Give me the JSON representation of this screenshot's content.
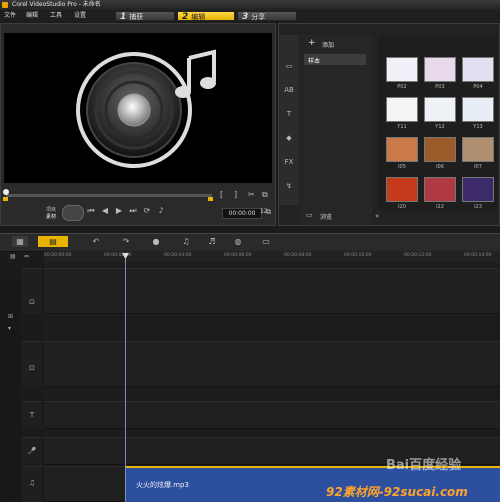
{
  "window": {
    "title": "Corel VideoStudio Pro - 未命名"
  },
  "menu": {
    "items": [
      "文件",
      "编辑",
      "工具",
      "设置"
    ]
  },
  "steps": [
    {
      "num": "1",
      "label": "捕获"
    },
    {
      "num": "2",
      "label": "编辑"
    },
    {
      "num": "3",
      "label": "分享"
    }
  ],
  "player": {
    "mode_top": "项目",
    "mode_bottom": "素材",
    "timecode": "00:00:00",
    "timecode_suffix": "12"
  },
  "library": {
    "add_label": "添加",
    "nav_items": [
      "样本"
    ],
    "browse_label": "浏览",
    "thumbnails": [
      "P02",
      "P03",
      "P04",
      "Y11",
      "Y12",
      "Y13",
      "I05",
      "I06",
      "I07",
      "I20",
      "I22",
      "I23"
    ]
  },
  "timeline": {
    "ruler": [
      "00:00:00:00",
      "00:00:02:00",
      "00:00:04:00",
      "00:00:06:00",
      "00:00:08:00",
      "00:00:10:00",
      "00:00:12:00",
      "00:00:14:00"
    ],
    "audio_clip": "火火的炫爆.mp3"
  },
  "watermark": {
    "top": "Bai百度经验",
    "bottom": "92素材网-92sucai.com"
  },
  "colors": {
    "accent": "#e8b400",
    "clip": "#2c4fa0"
  }
}
